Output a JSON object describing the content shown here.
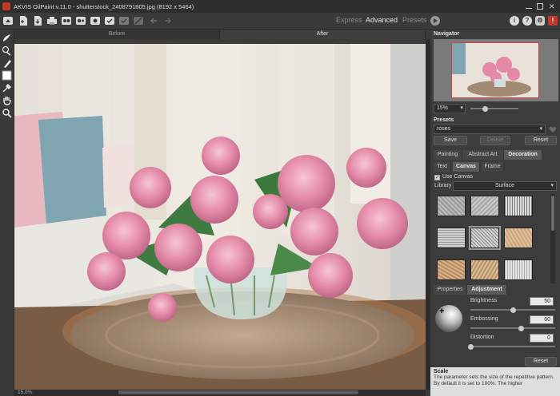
{
  "window": {
    "title": "AKVIS OilPaint v.11.0 - shutterstock_2408791805.jpg (8192 x 5464)"
  },
  "toolbar": {
    "modes": [
      "Express",
      "Advanced",
      "Presets"
    ],
    "active_mode": "Advanced",
    "icons": [
      "home-icon",
      "open-icon",
      "save-icon",
      "print-icon",
      "batch-icon",
      "share-icon",
      "settings-icon",
      "preset-icon",
      "apply-icon",
      "compare-icon",
      "undo-icon",
      "redo-icon"
    ],
    "right_icons": [
      "info-icon",
      "help-icon",
      "gear-icon",
      "notifications-icon"
    ]
  },
  "tools": [
    "brush-tool-icon",
    "history-brush-icon",
    "smudge-tool-icon",
    "color-swatch-icon",
    "eyedropper-icon",
    "hand-tool-icon",
    "zoom-tool-icon"
  ],
  "view_tabs": {
    "before": "Before",
    "after": "After",
    "active": "After"
  },
  "statusbar": {
    "zoom": "15.0%"
  },
  "navigator": {
    "title": "Navigator",
    "zoom": "15%",
    "zoom_slider": 0.3
  },
  "presets": {
    "title": "Presets",
    "selected": "roses",
    "save": "Save",
    "delete": "Delete",
    "reset": "Reset"
  },
  "main_tabs": {
    "painting": "Painting",
    "abstract_art": "Abstract Art",
    "decoration": "Decoration",
    "active": "Decoration"
  },
  "sub_tabs": {
    "text": "Text",
    "canvas": "Canvas",
    "frame": "Frame",
    "active": "Canvas"
  },
  "canvas_settings": {
    "use_canvas": "Use Canvas",
    "use_canvas_checked": true,
    "library_label": "Library",
    "library": "Surface"
  },
  "prop_tabs": {
    "properties": "Properties",
    "adjustment": "Adjustment",
    "active": "Adjustment"
  },
  "adjustment": {
    "brightness_label": "Brightness",
    "brightness": "50",
    "embossing_label": "Embossing",
    "embossing": "60",
    "distortion_label": "Distortion",
    "distortion": "0",
    "reset": "Reset"
  },
  "help": {
    "title": "Scale",
    "text": "The parameter sets the size of the repetitive pattern. By default it is set to 100%. The higher"
  }
}
